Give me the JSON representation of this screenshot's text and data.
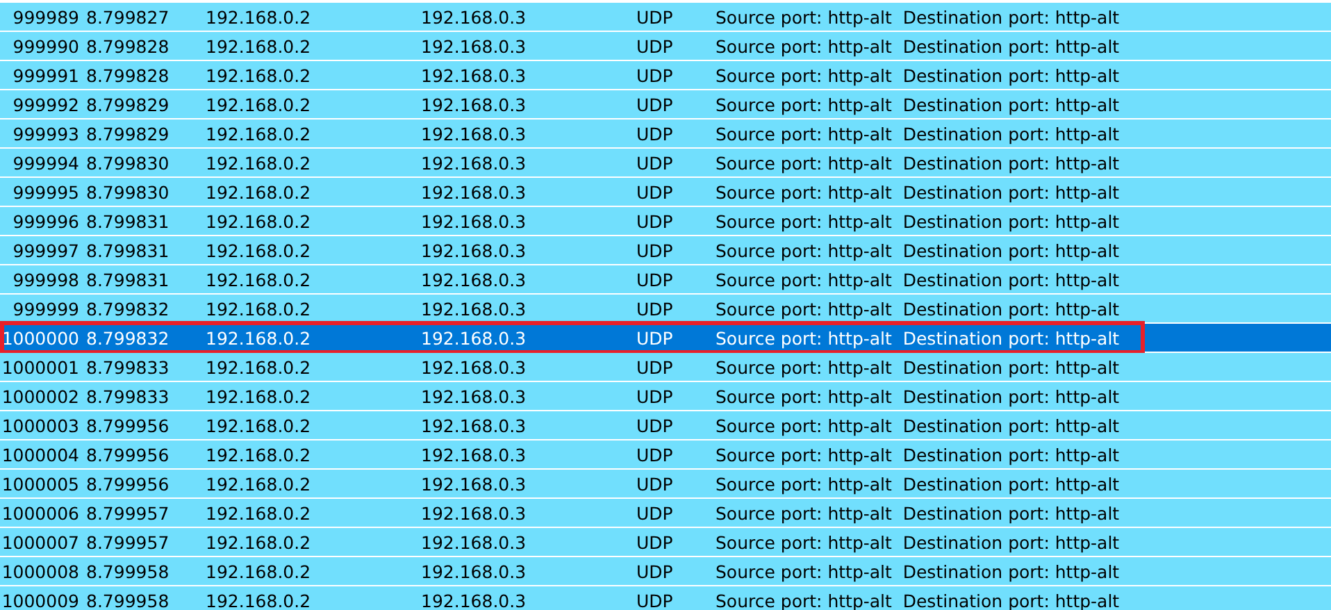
{
  "packets": [
    {
      "no": "999989",
      "time": "8.799827",
      "source": "192.168.0.2",
      "destination": "192.168.0.3",
      "protocol": "UDP",
      "info": "Source port: http-alt  Destination port: http-alt",
      "selected": false,
      "outlined": false
    },
    {
      "no": "999990",
      "time": "8.799828",
      "source": "192.168.0.2",
      "destination": "192.168.0.3",
      "protocol": "UDP",
      "info": "Source port: http-alt  Destination port: http-alt",
      "selected": false,
      "outlined": false
    },
    {
      "no": "999991",
      "time": "8.799828",
      "source": "192.168.0.2",
      "destination": "192.168.0.3",
      "protocol": "UDP",
      "info": "Source port: http-alt  Destination port: http-alt",
      "selected": false,
      "outlined": false
    },
    {
      "no": "999992",
      "time": "8.799829",
      "source": "192.168.0.2",
      "destination": "192.168.0.3",
      "protocol": "UDP",
      "info": "Source port: http-alt  Destination port: http-alt",
      "selected": false,
      "outlined": false
    },
    {
      "no": "999993",
      "time": "8.799829",
      "source": "192.168.0.2",
      "destination": "192.168.0.3",
      "protocol": "UDP",
      "info": "Source port: http-alt  Destination port: http-alt",
      "selected": false,
      "outlined": false
    },
    {
      "no": "999994",
      "time": "8.799830",
      "source": "192.168.0.2",
      "destination": "192.168.0.3",
      "protocol": "UDP",
      "info": "Source port: http-alt  Destination port: http-alt",
      "selected": false,
      "outlined": false
    },
    {
      "no": "999995",
      "time": "8.799830",
      "source": "192.168.0.2",
      "destination": "192.168.0.3",
      "protocol": "UDP",
      "info": "Source port: http-alt  Destination port: http-alt",
      "selected": false,
      "outlined": false
    },
    {
      "no": "999996",
      "time": "8.799831",
      "source": "192.168.0.2",
      "destination": "192.168.0.3",
      "protocol": "UDP",
      "info": "Source port: http-alt  Destination port: http-alt",
      "selected": false,
      "outlined": false
    },
    {
      "no": "999997",
      "time": "8.799831",
      "source": "192.168.0.2",
      "destination": "192.168.0.3",
      "protocol": "UDP",
      "info": "Source port: http-alt  Destination port: http-alt",
      "selected": false,
      "outlined": false
    },
    {
      "no": "999998",
      "time": "8.799831",
      "source": "192.168.0.2",
      "destination": "192.168.0.3",
      "protocol": "UDP",
      "info": "Source port: http-alt  Destination port: http-alt",
      "selected": false,
      "outlined": false
    },
    {
      "no": "999999",
      "time": "8.799832",
      "source": "192.168.0.2",
      "destination": "192.168.0.3",
      "protocol": "UDP",
      "info": "Source port: http-alt  Destination port: http-alt",
      "selected": false,
      "outlined": false
    },
    {
      "no": "1000000",
      "time": "8.799832",
      "source": "192.168.0.2",
      "destination": "192.168.0.3",
      "protocol": "UDP",
      "info": "Source port: http-alt  Destination port: http-alt",
      "selected": true,
      "outlined": true
    },
    {
      "no": "1000001",
      "time": "8.799833",
      "source": "192.168.0.2",
      "destination": "192.168.0.3",
      "protocol": "UDP",
      "info": "Source port: http-alt  Destination port: http-alt",
      "selected": false,
      "outlined": false
    },
    {
      "no": "1000002",
      "time": "8.799833",
      "source": "192.168.0.2",
      "destination": "192.168.0.3",
      "protocol": "UDP",
      "info": "Source port: http-alt  Destination port: http-alt",
      "selected": false,
      "outlined": false
    },
    {
      "no": "1000003",
      "time": "8.799956",
      "source": "192.168.0.2",
      "destination": "192.168.0.3",
      "protocol": "UDP",
      "info": "Source port: http-alt  Destination port: http-alt",
      "selected": false,
      "outlined": false
    },
    {
      "no": "1000004",
      "time": "8.799956",
      "source": "192.168.0.2",
      "destination": "192.168.0.3",
      "protocol": "UDP",
      "info": "Source port: http-alt  Destination port: http-alt",
      "selected": false,
      "outlined": false
    },
    {
      "no": "1000005",
      "time": "8.799956",
      "source": "192.168.0.2",
      "destination": "192.168.0.3",
      "protocol": "UDP",
      "info": "Source port: http-alt  Destination port: http-alt",
      "selected": false,
      "outlined": false
    },
    {
      "no": "1000006",
      "time": "8.799957",
      "source": "192.168.0.2",
      "destination": "192.168.0.3",
      "protocol": "UDP",
      "info": "Source port: http-alt  Destination port: http-alt",
      "selected": false,
      "outlined": false
    },
    {
      "no": "1000007",
      "time": "8.799957",
      "source": "192.168.0.2",
      "destination": "192.168.0.3",
      "protocol": "UDP",
      "info": "Source port: http-alt  Destination port: http-alt",
      "selected": false,
      "outlined": false
    },
    {
      "no": "1000008",
      "time": "8.799958",
      "source": "192.168.0.2",
      "destination": "192.168.0.3",
      "protocol": "UDP",
      "info": "Source port: http-alt  Destination port: http-alt",
      "selected": false,
      "outlined": false
    },
    {
      "no": "1000009",
      "time": "8.799958",
      "source": "192.168.0.2",
      "destination": "192.168.0.3",
      "protocol": "UDP",
      "info": "Source port: http-alt  Destination port: http-alt",
      "selected": false,
      "outlined": false
    }
  ]
}
